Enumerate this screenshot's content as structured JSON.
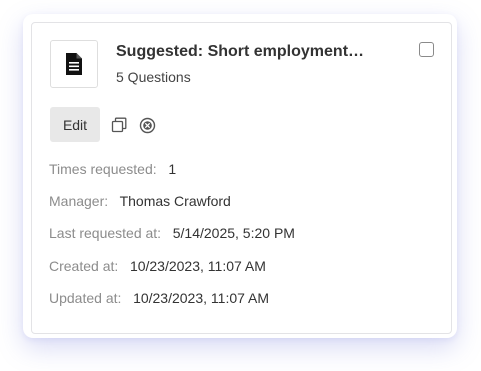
{
  "card": {
    "title": "Suggested: Short employment…",
    "subtitle": "5 Questions",
    "icons": {
      "thumbnail": "document-icon",
      "copy": "copy-icon",
      "remove": "remove-circle-icon"
    },
    "edit_label": "Edit",
    "details": {
      "times_requested": {
        "label": "Times requested:",
        "value": "1"
      },
      "manager": {
        "label": "Manager:",
        "value": "Thomas Crawford"
      },
      "last_requested": {
        "label": "Last requested at:",
        "value": "5/14/2025, 5:20 PM"
      },
      "created": {
        "label": "Created at:",
        "value": "10/23/2023, 11:07 AM"
      },
      "updated": {
        "label": "Updated at:",
        "value": "10/23/2023, 11:07 AM"
      }
    }
  },
  "colors": {
    "shadow": "#787ddc",
    "label": "#8c8c8c",
    "value": "#333333",
    "edit_bg": "#e8e8e8"
  }
}
